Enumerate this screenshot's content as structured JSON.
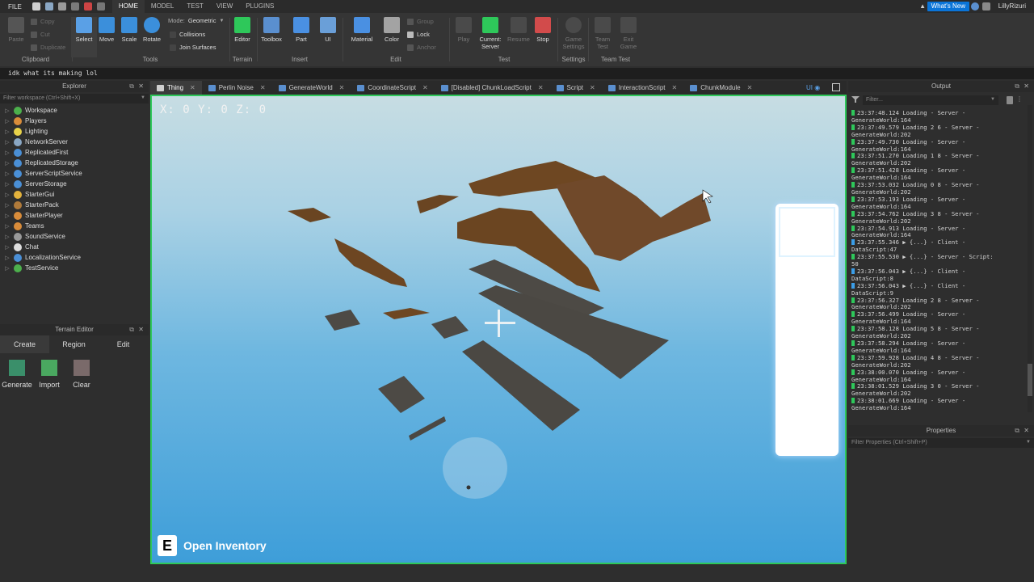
{
  "menubar": {
    "file": "FILE",
    "tabs": [
      "HOME",
      "MODEL",
      "TEST",
      "VIEW",
      "PLUGINS"
    ],
    "whats_new": "What's New",
    "username": "LillyRizuri"
  },
  "ribbon": {
    "clipboard": {
      "label": "Clipboard",
      "paste": "Paste",
      "copy": "Copy",
      "cut": "Cut",
      "duplicate": "Duplicate"
    },
    "tools": {
      "label": "Tools",
      "select": "Select",
      "move": "Move",
      "scale": "Scale",
      "rotate": "Rotate",
      "mode_label": "Mode:",
      "mode_value": "Geometric",
      "collisions": "Collisions",
      "join_surfaces": "Join Surfaces"
    },
    "terrain": {
      "label": "Terrain",
      "editor": "Editor"
    },
    "insert": {
      "label": "Insert",
      "toolbox": "Toolbox",
      "part": "Part",
      "ui": "UI"
    },
    "edit": {
      "label": "Edit",
      "material": "Material",
      "color": "Color",
      "group": "Group",
      "lock": "Lock",
      "anchor": "Anchor"
    },
    "test": {
      "label": "Test",
      "play": "Play",
      "current": "Current:",
      "server": "Server",
      "resume": "Resume",
      "stop": "Stop"
    },
    "settings": {
      "label": "Settings",
      "game_settings_1": "Game",
      "game_settings_2": "Settings"
    },
    "team_test": {
      "label": "Team Test",
      "team_test_1": "Team",
      "team_test_2": "Test",
      "exit_game_1": "Exit",
      "exit_game_2": "Game"
    }
  },
  "command_bar": {
    "text": "idk what its making lol"
  },
  "explorer": {
    "title": "Explorer",
    "filter_placeholder": "Filter workspace (Ctrl+Shift+X)",
    "items": [
      {
        "label": "Workspace",
        "color": "#4cb04c"
      },
      {
        "label": "Players",
        "color": "#d98c3a"
      },
      {
        "label": "Lighting",
        "color": "#e8d24a"
      },
      {
        "label": "NetworkServer",
        "color": "#8aa7c4"
      },
      {
        "label": "ReplicatedFirst",
        "color": "#4a8fd6"
      },
      {
        "label": "ReplicatedStorage",
        "color": "#4a8fd6"
      },
      {
        "label": "ServerScriptService",
        "color": "#4a8fd6"
      },
      {
        "label": "ServerStorage",
        "color": "#4a8fd6"
      },
      {
        "label": "StarterGui",
        "color": "#e3b23c"
      },
      {
        "label": "StarterPack",
        "color": "#b07a3a"
      },
      {
        "label": "StarterPlayer",
        "color": "#d98c3a"
      },
      {
        "label": "Teams",
        "color": "#d98c3a"
      },
      {
        "label": "SoundService",
        "color": "#9a9a9a"
      },
      {
        "label": "Chat",
        "color": "#dddddd"
      },
      {
        "label": "LocalizationService",
        "color": "#4a8fd6"
      },
      {
        "label": "TestService",
        "color": "#4cb04c"
      }
    ]
  },
  "terrain_editor": {
    "title": "Terrain Editor",
    "tabs": [
      "Create",
      "Region",
      "Edit"
    ],
    "buttons": [
      "Generate",
      "Import",
      "Clear"
    ]
  },
  "doc_tabs": [
    "Thing",
    "Perlin Noise",
    "GenerateWorld",
    "CoordinateScript",
    "[Disabled] ChunkLoadScript",
    "Script",
    "InteractionScript",
    "ChunkModule"
  ],
  "viewport": {
    "coords": "X: 0 Y: 0 Z: 0",
    "inventory_key": "E",
    "inventory_label": "Open Inventory",
    "ui_toggle": "UI"
  },
  "output": {
    "title": "Output",
    "filter_placeholder": "Filter...",
    "lines": [
      {
        "t": "23:37:48.124  Loading  -  Server -",
        "m": "g"
      },
      {
        "t": "GenerateWorld:164",
        "m": ""
      },
      {
        "t": "23:37:49.579  Loading 2 6  -  Server -",
        "m": "g"
      },
      {
        "t": "GenerateWorld:202",
        "m": ""
      },
      {
        "t": "23:37:49.730  Loading  -  Server -",
        "m": "g"
      },
      {
        "t": "GenerateWorld:164",
        "m": ""
      },
      {
        "t": "23:37:51.270  Loading 1 8  -  Server -",
        "m": "g"
      },
      {
        "t": "GenerateWorld:202",
        "m": ""
      },
      {
        "t": "23:37:51.428  Loading  -  Server -",
        "m": "g"
      },
      {
        "t": "GenerateWorld:164",
        "m": ""
      },
      {
        "t": "23:37:53.032  Loading 0 8  -  Server -",
        "m": "g"
      },
      {
        "t": "GenerateWorld:202",
        "m": ""
      },
      {
        "t": "23:37:53.193  Loading  -  Server -",
        "m": "g"
      },
      {
        "t": "GenerateWorld:164",
        "m": ""
      },
      {
        "t": "23:37:54.762  Loading 3 8  -  Server -",
        "m": "g"
      },
      {
        "t": "GenerateWorld:202",
        "m": ""
      },
      {
        "t": "23:37:54.913  Loading  -  Server -",
        "m": "g"
      },
      {
        "t": "GenerateWorld:164",
        "m": ""
      },
      {
        "t": "23:37:55.346  ▶ {...}  -  Client -",
        "m": "b"
      },
      {
        "t": "DataScript:47",
        "m": ""
      },
      {
        "t": "23:37:55.530  ▶ {...}  -  Server - Script:",
        "m": "g"
      },
      {
        "t": "50",
        "m": ""
      },
      {
        "t": "23:37:56.043  ▶ {...}  -  Client -",
        "m": "b"
      },
      {
        "t": "DataScript:8",
        "m": ""
      },
      {
        "t": "23:37:56.043  ▶ {...}  -  Client -",
        "m": "b"
      },
      {
        "t": "DataScript:9",
        "m": ""
      },
      {
        "t": "23:37:56.327  Loading 2 8  -  Server -",
        "m": "g"
      },
      {
        "t": "GenerateWorld:202",
        "m": ""
      },
      {
        "t": "23:37:56.499  Loading  -  Server -",
        "m": "g"
      },
      {
        "t": "GenerateWorld:164",
        "m": ""
      },
      {
        "t": "23:37:58.128  Loading 5 8  -  Server -",
        "m": "g"
      },
      {
        "t": "GenerateWorld:202",
        "m": ""
      },
      {
        "t": "23:37:58.294  Loading  -  Server -",
        "m": "g"
      },
      {
        "t": "GenerateWorld:164",
        "m": ""
      },
      {
        "t": "23:37:59.928  Loading 4 8  -  Server -",
        "m": "g"
      },
      {
        "t": "GenerateWorld:202",
        "m": ""
      },
      {
        "t": "23:38:00.070  Loading  -  Server -",
        "m": "g"
      },
      {
        "t": "GenerateWorld:164",
        "m": ""
      },
      {
        "t": "23:38:01.529  Loading 3 0  -  Server -",
        "m": "g"
      },
      {
        "t": "GenerateWorld:202",
        "m": ""
      },
      {
        "t": "23:38:01.669  Loading  -  Server -",
        "m": "g"
      },
      {
        "t": "GenerateWorld:164",
        "m": ""
      }
    ]
  },
  "properties": {
    "title": "Properties",
    "filter_placeholder": "Filter Properties (Ctrl+Shift+P)"
  }
}
